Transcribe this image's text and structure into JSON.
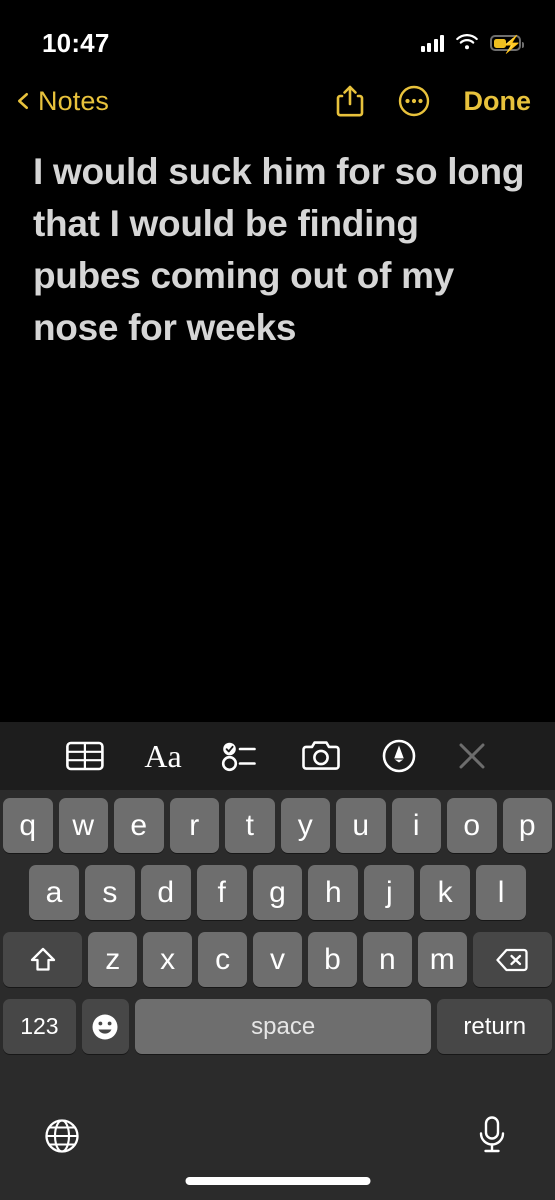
{
  "status_bar": {
    "time": "10:47",
    "cellular_icon": "cellular-signal-icon",
    "wifi_icon": "wifi-icon",
    "battery_icon": "battery-charging-icon",
    "battery_charging": true
  },
  "nav_bar": {
    "back_label": "Notes",
    "back_icon": "chevron-left-icon",
    "share_icon": "share-icon",
    "more_icon": "ellipsis-circle-icon",
    "done_label": "Done",
    "accent_color": "#e8c23c"
  },
  "note": {
    "body": "I would suck him for so long that I would be finding pubes coming out of my nose for weeks",
    "text_color": "#d6d6d6",
    "background_color": "#000000"
  },
  "format_toolbar": {
    "items": [
      {
        "name": "table-icon",
        "label": ""
      },
      {
        "name": "text-format-icon",
        "label": "Aa"
      },
      {
        "name": "checklist-icon",
        "label": ""
      },
      {
        "name": "camera-icon",
        "label": ""
      },
      {
        "name": "markup-pen-icon",
        "label": ""
      },
      {
        "name": "close-icon",
        "label": ""
      }
    ],
    "background_color": "#1d1d1d"
  },
  "keyboard": {
    "background_color": "#2b2b2b",
    "key_color": "#6e6e6e",
    "modifier_key_color": "#474747",
    "row1": [
      "q",
      "w",
      "e",
      "r",
      "t",
      "y",
      "u",
      "i",
      "o",
      "p"
    ],
    "row2": [
      "a",
      "s",
      "d",
      "f",
      "g",
      "h",
      "j",
      "k",
      "l"
    ],
    "row3_letters": [
      "z",
      "x",
      "c",
      "v",
      "b",
      "n",
      "m"
    ],
    "shift_icon": "shift-icon",
    "backspace_icon": "backspace-icon",
    "numbers_label": "123",
    "emoji_icon": "emoji-icon",
    "space_label": "space",
    "return_label": "return"
  },
  "bottom_bar": {
    "globe_icon": "globe-icon",
    "microphone_icon": "microphone-icon",
    "home_indicator": "home-indicator"
  }
}
